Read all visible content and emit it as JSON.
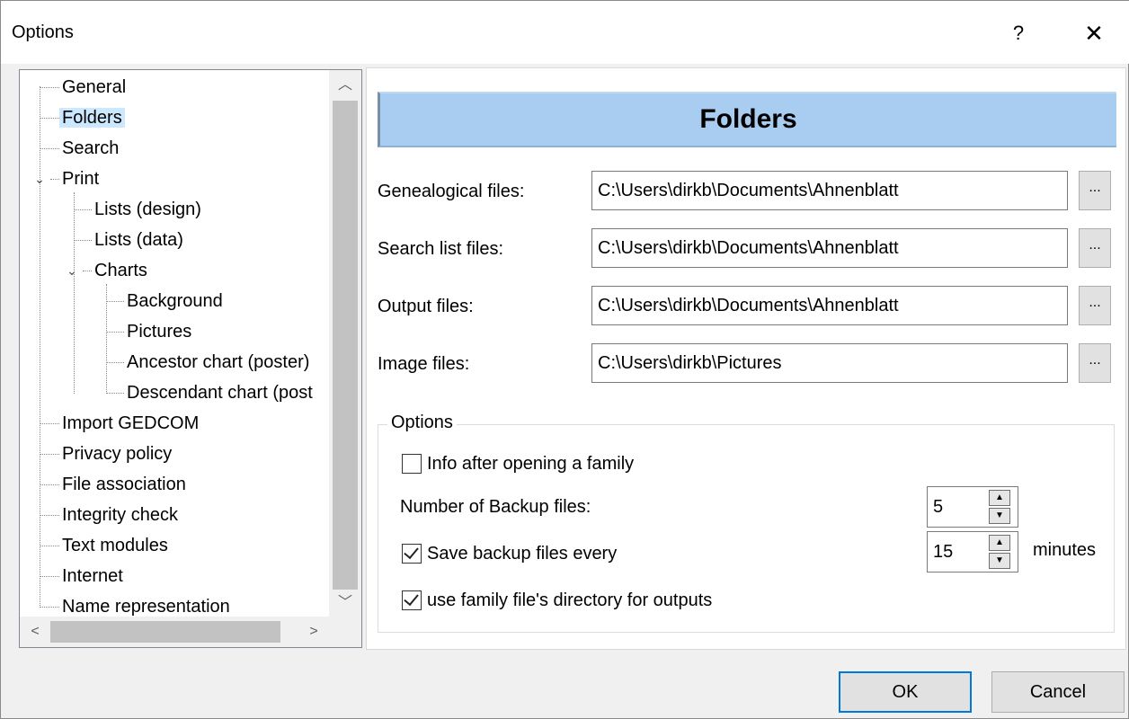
{
  "window": {
    "title": "Options",
    "help_glyph": "?",
    "close_glyph": "✕"
  },
  "tree": {
    "items": [
      {
        "label": "General"
      },
      {
        "label": "Folders"
      },
      {
        "label": "Search"
      },
      {
        "label": "Print"
      },
      {
        "label": "Lists (design)"
      },
      {
        "label": "Lists (data)"
      },
      {
        "label": "Charts"
      },
      {
        "label": "Background"
      },
      {
        "label": "Pictures"
      },
      {
        "label": "Ancestor chart (poster)"
      },
      {
        "label": "Descendant chart (post"
      },
      {
        "label": "Import GEDCOM"
      },
      {
        "label": "Privacy policy"
      },
      {
        "label": "File association"
      },
      {
        "label": "Integrity check"
      },
      {
        "label": "Text modules"
      },
      {
        "label": "Internet"
      },
      {
        "label": "Name representation"
      }
    ],
    "selected": "Folders"
  },
  "header": {
    "title": "Folders"
  },
  "folders": [
    {
      "label": "Genealogical files:",
      "value": "C:\\Users\\dirkb\\Documents\\Ahnenblatt",
      "browse": "..."
    },
    {
      "label": "Search list files:",
      "value": "C:\\Users\\dirkb\\Documents\\Ahnenblatt",
      "browse": "..."
    },
    {
      "label": "Output files:",
      "value": "C:\\Users\\dirkb\\Documents\\Ahnenblatt",
      "browse": "..."
    },
    {
      "label": "Image files:",
      "value": "C:\\Users\\dirkb\\Pictures",
      "browse": "..."
    }
  ],
  "options": {
    "group_title": "Options",
    "info_after_opening": {
      "label": "Info after opening a family",
      "checked": false
    },
    "backup_count": {
      "label": "Number of Backup files:",
      "value": "5"
    },
    "save_backup": {
      "label": "Save backup files every",
      "checked": true,
      "value": "15",
      "unit": "minutes"
    },
    "use_family_dir": {
      "label": "use family file's directory for outputs",
      "checked": true
    }
  },
  "buttons": {
    "ok": "OK",
    "cancel": "Cancel"
  },
  "colors": {
    "header_bg": "#a8cdf0",
    "selection": "#cce8ff",
    "default_button_border": "#0078d7"
  }
}
